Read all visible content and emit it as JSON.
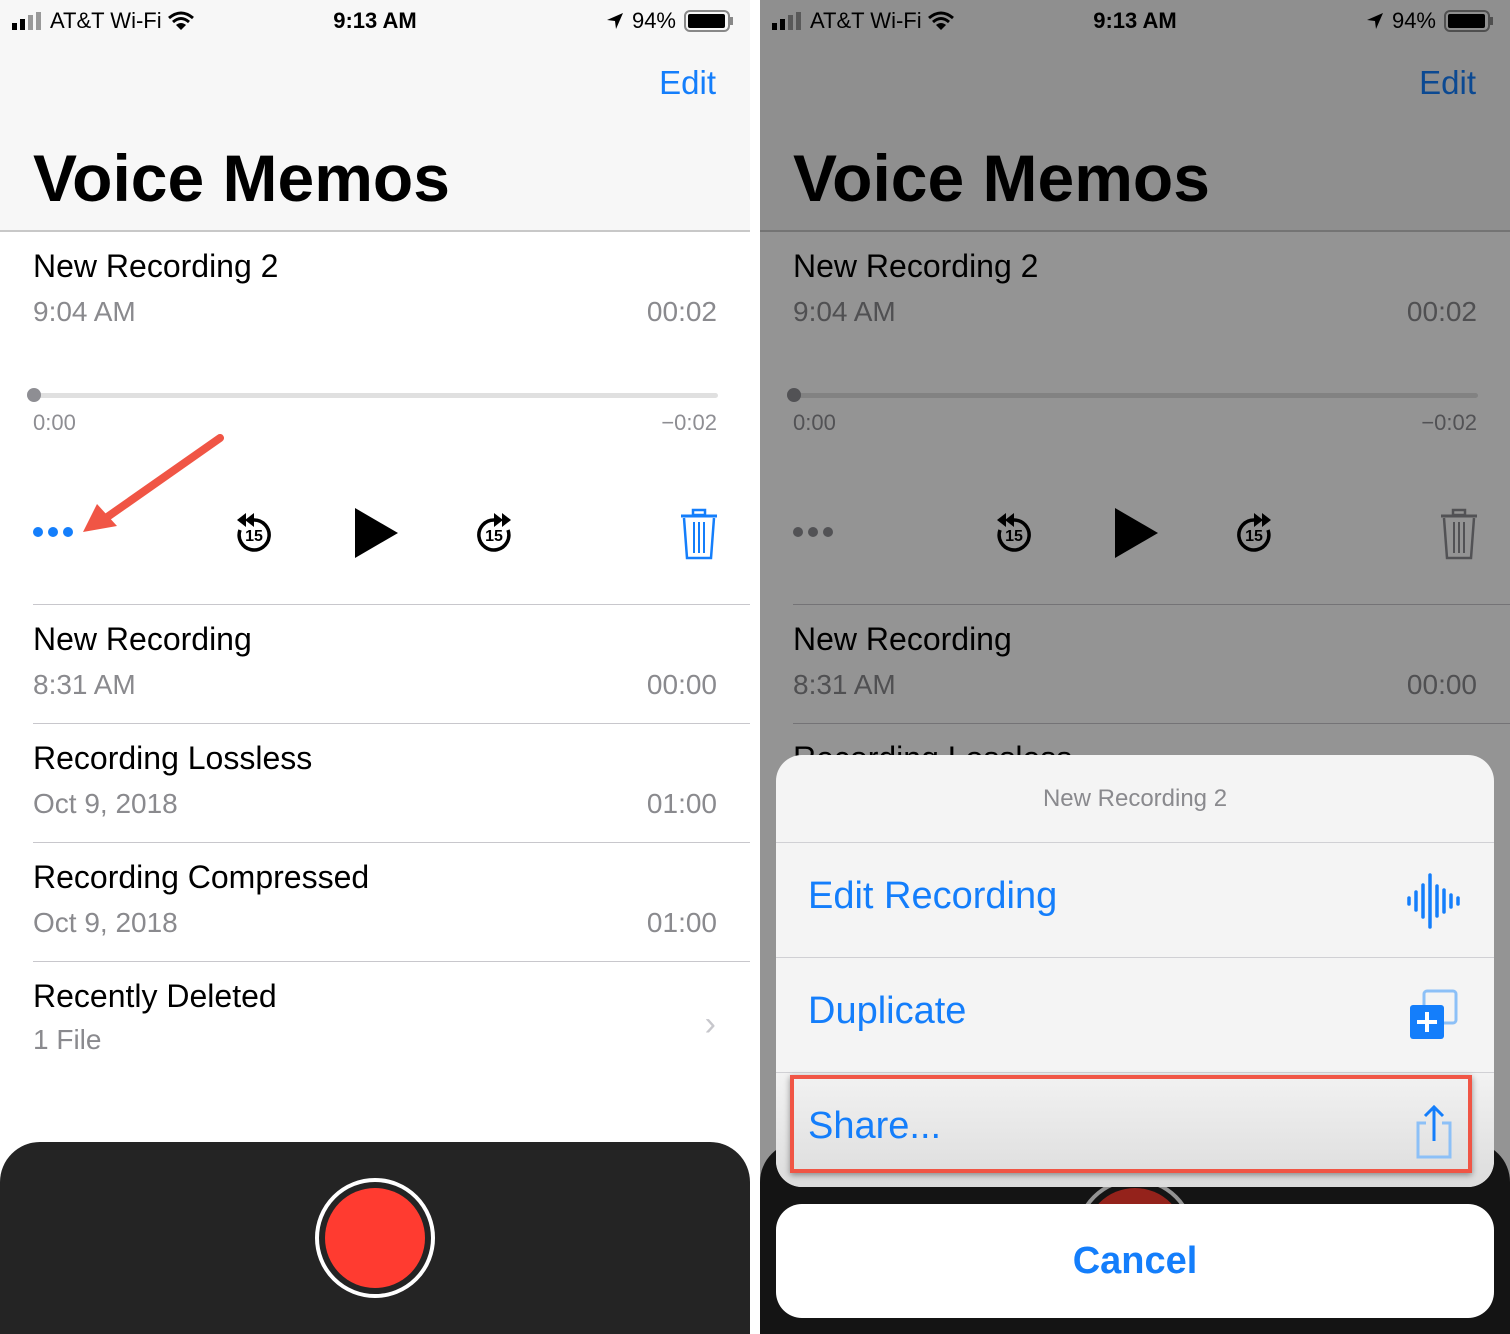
{
  "status_bar": {
    "carrier": "AT&T Wi-Fi",
    "time": "9:13 AM",
    "battery": "94%",
    "battery_level": 0.94
  },
  "nav": {
    "edit_label": "Edit",
    "title": "Voice Memos"
  },
  "expanded": {
    "name": "New Recording 2",
    "date": "9:04 AM",
    "duration": "00:02",
    "elapsed": "0:00",
    "remaining": "−0:02",
    "progress": 0,
    "skip_seconds": "15"
  },
  "recordings": [
    {
      "name": "New Recording",
      "date": "8:31 AM",
      "duration": "00:00"
    },
    {
      "name": "Recording Lossless",
      "date": "Oct 9, 2018",
      "duration": "01:00"
    },
    {
      "name": "Recording Compressed",
      "date": "Oct 9, 2018",
      "duration": "01:00"
    }
  ],
  "recently_deleted": {
    "name": "Recently Deleted",
    "count": "1 File"
  },
  "action_sheet": {
    "title": "New Recording 2",
    "items": [
      {
        "label": "Edit Recording",
        "icon": "waveform-icon"
      },
      {
        "label": "Duplicate",
        "icon": "duplicate-icon"
      },
      {
        "label": "Share...",
        "icon": "share-icon"
      }
    ],
    "cancel_label": "Cancel"
  },
  "colors": {
    "accent": "#147efb",
    "record": "#ff3b30",
    "annotation": "#f05545"
  }
}
